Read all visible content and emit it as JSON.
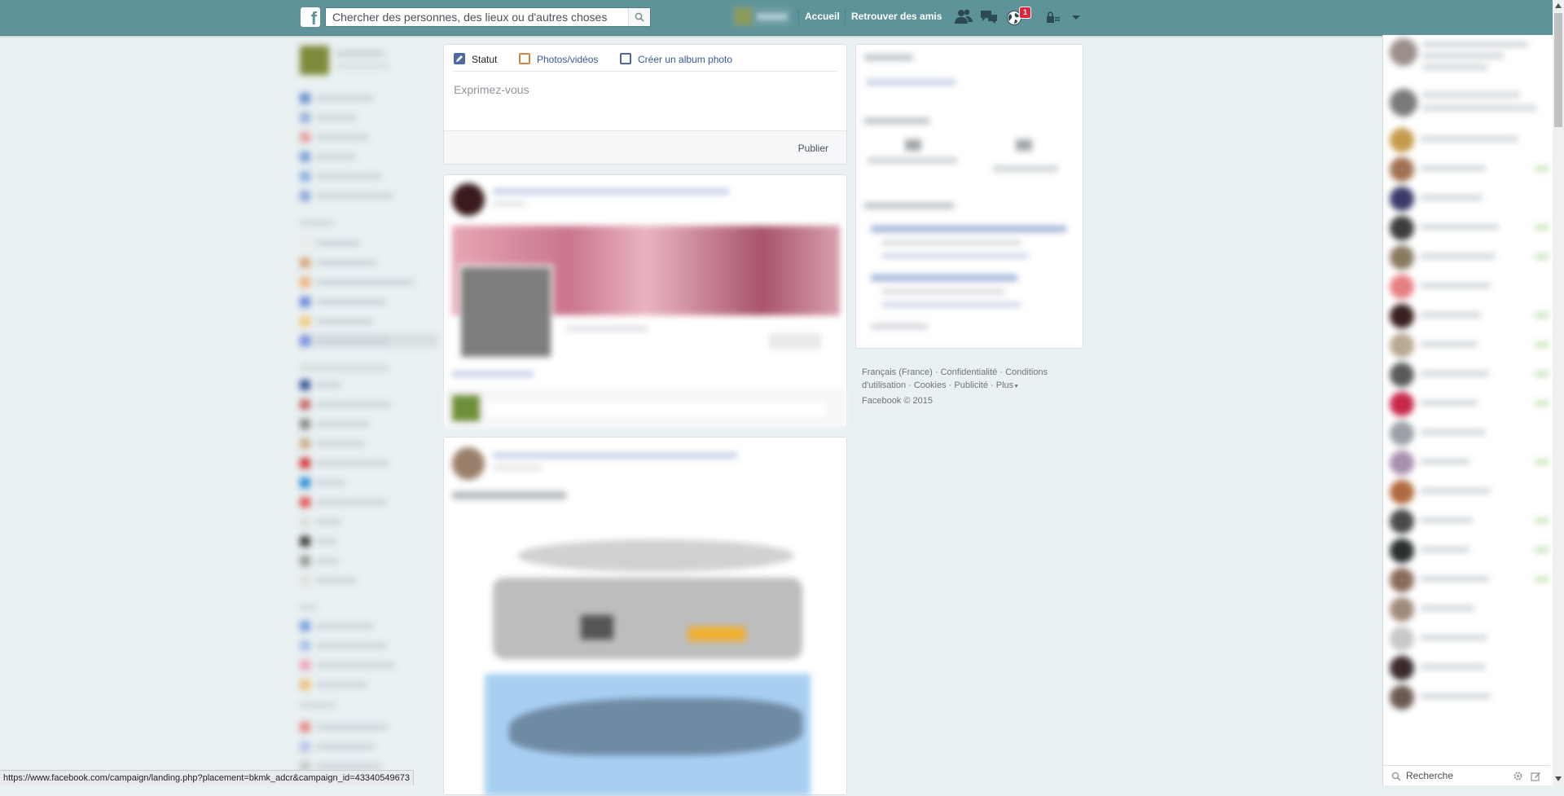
{
  "topbar": {
    "logo": "f",
    "search_placeholder": "Chercher des personnes, des lieux ou d'autres choses",
    "nav_home": "Accueil",
    "nav_find_friends": "Retrouver des amis",
    "notifications_count": "1",
    "icons": [
      "friend-requests-icon",
      "messages-icon",
      "notifications-globe-icon",
      "privacy-lock-icon",
      "account-menu-chevron-icon"
    ]
  },
  "composer": {
    "tabs": [
      {
        "label": "Statut",
        "icon": "pencil-icon"
      },
      {
        "label": "Photos/vidéos",
        "icon": "photo-icon"
      },
      {
        "label": "Créer un album photo",
        "icon": "album-icon"
      }
    ],
    "placeholder": "Exprimez-vous",
    "publish_label": "Publier"
  },
  "footer": {
    "links": [
      "Français (France)",
      "Confidentialité",
      "Conditions d'utilisation",
      "Cookies",
      "Publicité",
      "Plus"
    ],
    "copyright": "Facebook © 2015"
  },
  "chat": {
    "search_placeholder": "Recherche"
  },
  "status_bar": {
    "url": "https://www.facebook.com/campaign/landing.php?placement=bkmk_adcr&campaign_id=43340549673"
  },
  "colors": {
    "topbar": "#5f939a",
    "page_bg": "#e9f1f2",
    "badge": "#e0243c"
  }
}
